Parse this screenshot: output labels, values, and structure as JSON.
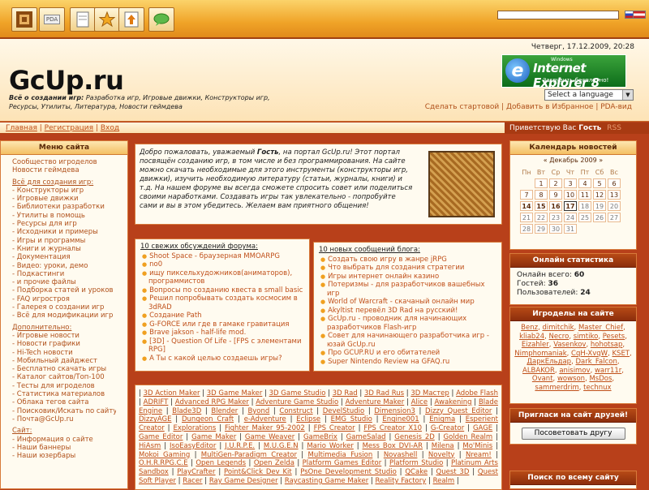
{
  "toolbar": {
    "btn2": "PDA"
  },
  "header": {
    "date": "Четверг, 17.12.2009, 20:28",
    "logo": "GcUp.ru",
    "tagline_bold": "Всё о создании игр:",
    "tagline": " Разработка игр, Игровые движки, Конструкторы игр, Ресурсы, Утилиты, Литература, Новости геймдева",
    "ie_small": "Windows",
    "ie_big": "Internet Explorer 8",
    "ie_sub": "Загрузить бесплатно!",
    "lang": "Select a language",
    "links": "Сделать стартовой | Добавить в Избранное | PDA-вид"
  },
  "nav": {
    "home": "Главная",
    "reg": "Регистрация",
    "login": "Вход",
    "sep": "|",
    "greet": "Приветствую Вас",
    "guest": "Гость",
    "rss": "RSS"
  },
  "menu": {
    "title": "Меню сайта",
    "items": [
      {
        "t": "Сообщество игроделов",
        "s": false
      },
      {
        "t": "Новости геймдева",
        "s": false
      },
      {
        "t": "Всё для создания игр:",
        "s": true
      },
      {
        "t": "- Конструкторы игр",
        "s": false
      },
      {
        "t": "- Игровые движки",
        "s": false
      },
      {
        "t": "- Библиотеки разработки",
        "s": false
      },
      {
        "t": "- Утилиты в помощь",
        "s": false
      },
      {
        "t": "- Ресурсы для игр",
        "s": false
      },
      {
        "t": "- Исходники и примеры",
        "s": false
      },
      {
        "t": "- Игры и программы",
        "s": false
      },
      {
        "t": "- Книги и журналы",
        "s": false
      },
      {
        "t": "- Документация",
        "s": false
      },
      {
        "t": "- Видео: уроки, демо",
        "s": false
      },
      {
        "t": "- Подкаст​инги",
        "s": false
      },
      {
        "t": "- и прочие файлы",
        "s": false
      },
      {
        "t": "- Подборка статей и уроков",
        "s": false
      },
      {
        "t": "- FAQ игрострoя",
        "s": false
      },
      {
        "t": "- Галерея о создании игр",
        "s": false
      },
      {
        "t": "- Всё для модификации игр",
        "s": false
      },
      {
        "t": "Дополнительно:",
        "s": true
      },
      {
        "t": "- Игровые новости",
        "s": false
      },
      {
        "t": "- Новости графики",
        "s": false
      },
      {
        "t": "- Hi-Tech новости",
        "s": false
      },
      {
        "t": "- Мобильный дайджест",
        "s": false
      },
      {
        "t": "- Бесплатно скачать игры",
        "s": false
      },
      {
        "t": "- Каталог сайтов/Топ-100",
        "s": false
      },
      {
        "t": "- Тесты для игроделов",
        "s": false
      },
      {
        "t": "- Статистика материалов",
        "s": false
      },
      {
        "t": "- Облака тегов сайта",
        "s": false
      },
      {
        "t": "- Поисковик/Искать по сайту",
        "s": false
      },
      {
        "t": "- Почта@GcUp.ru",
        "s": false
      },
      {
        "t": "Сайт:",
        "s": true
      },
      {
        "t": "- Информация о сайте",
        "s": false
      },
      {
        "t": "- Наши баннеры",
        "s": false
      },
      {
        "t": "- Наши юзербары",
        "s": false
      }
    ]
  },
  "welcome": {
    "a": "Добро пожаловать, уважаемый ",
    "guest": "Гость",
    "b": ", на портал GcUp.ru! Этот портал посвящён созданию игр, в том числе и без программирования. На сайте можно скачать необходимые для этого инструменты (конструкторы игр, движки), изучить необходимую литературу (статьи, журналы, книги) и т.д. На нашем форуме вы всегда сможете спросить совет или поделиться своими наработками. Создавать игры так увлекательно - попробуйте сами и вы в этом убедитесь. Желаем вам приятного общения!"
  },
  "forum": {
    "title": "10 свежих обсуждений форума:",
    "items": [
      "Shoot Space - браузерная MMOARPG",
      "no0",
      "ищу пиксельхудожников(аниматоров), программистов",
      "Вопросы по созданию квеста в small basic",
      "Решил попробывать создать космосим в 3dRAD",
      "Создание Path",
      "G-FORCE или где в гамаке гравитация",
      "Brave jakson - half-life mod.",
      "[3D] - Question Of Life - [FPS с элементами RPG]",
      "А Ты с какой целью создаешь игры?"
    ]
  },
  "blog": {
    "title": "10 новых сообщений блога:",
    "items": [
      "Создать свою игру в жанре jRPG",
      "Что выбрать для создания стратегии",
      "Игры интернет онлайн казино",
      "Потеризмы - для разработчиков вашебных игр",
      "World of Warcraft - скачаный онлайн мир",
      "Akyltist перевёл 3D Rad на русский!",
      "GcUp.ru - проводник для начинающих разработчиков Flash-игр",
      "Совет для начинающего разработчика игр - юзай GcUp.ru",
      "Про GCUP.RU и его обитателей",
      "Super Nintendo Review на GFAQ.ru"
    ]
  },
  "catalog": [
    "3D Action Maker",
    "3D Game Maker",
    "3D Game Studio",
    "3D Rad",
    "3D Rad Rus",
    "3D Мастер",
    "Adobe Flash",
    "ADRIFT",
    "Advanced RPG Maker",
    "Adventure Game Studio",
    "Adventure Maker",
    "Alice",
    "Awakening",
    "Blade Engine",
    "Blade3D",
    "Blender",
    "Byond",
    "Construct",
    "DevelStudio",
    "Dimension3",
    "Dizzy Quest Editor",
    "DizzyAGE",
    "Dungeon Craft",
    "e-Adventure",
    "Eclipse",
    "EMG Studio",
    "Engine001",
    "Enigma",
    "Esperient Creator",
    "Explorations",
    "Fighter Maker 95-2002",
    "FPS Creator",
    "FPS Creator X10",
    "G-Creator",
    "GAGE",
    "Game Editor",
    "Game Maker",
    "Game Weaver",
    "GameBrix",
    "GameSalad",
    "Genesis 2D",
    "Golden Realm",
    "HiAsm",
    "IsoEasyEditor",
    "J.U.R.P.E.",
    "M.U.G.E.N",
    "Mario Worker",
    "Mess Box DVI-AR",
    "Milena",
    "Mo'Minis",
    "Mokoi Gaming",
    "MultiGen-Paradigm Creator",
    "Multimedia Fusion",
    "Novashell",
    "Novelty",
    "Nream!",
    "O.H.R.RPG.C.E",
    "Open Legends",
    "Open Zelda",
    "Platform Games Editor",
    "Platform Studio",
    "Platinum Arts Sandbox",
    "PlayCrafter",
    "Point&Click Dev Kit",
    "PsOne Development Studio",
    "QCake",
    "Quest 3D",
    "Quest Soft Player",
    "Racer",
    "Ray Game Designer",
    "Raycasting Game Maker",
    "Reality Factory",
    "Realm"
  ],
  "calendar": {
    "title": "Календарь новостей",
    "month": "« Декабрь 2009 »",
    "wk": [
      "Пн",
      "Вт",
      "Ср",
      "Чт",
      "Пт",
      "Сб",
      "Вс"
    ],
    "rows": [
      [
        "",
        "1",
        "2",
        "3",
        "4",
        "5",
        "6"
      ],
      [
        "7",
        "8",
        "9",
        "10",
        "11",
        "12",
        "13"
      ],
      [
        "14",
        "15",
        "16",
        "17",
        "18",
        "19",
        "20"
      ],
      [
        "21",
        "22",
        "23",
        "24",
        "25",
        "26",
        "27"
      ],
      [
        "28",
        "29",
        "30",
        "31",
        "",
        "",
        ""
      ]
    ]
  },
  "stats": {
    "title": "Онлайн статистика",
    "l1": "Онлайн всего:",
    "v1": "60",
    "l2": "Гостей:",
    "v2": "36",
    "l3": "Пользователей:",
    "v3": "24"
  },
  "online": {
    "title": "Игроделы на сайте",
    "users": [
      "Benz",
      "dimitchik",
      "Master_Chief",
      "kliab24",
      "Necro",
      "simtiko",
      "Pesets",
      "Eizahler",
      "Vasenkov",
      "hohotsap",
      "Nimphomaniak",
      "CqH-XvqW",
      "KSET",
      "ДаркЕльдар",
      "Dark_Falcon",
      "ALBAKOR",
      "anisimov",
      "warr11r",
      "Ovant",
      "wowson",
      "MsDos",
      "sammerdrim",
      "technux"
    ]
  },
  "invite": {
    "title": "Пригласи на сайт друзей!",
    "btn": "Посоветовать другу"
  },
  "search": {
    "title": "Поиск по всему сайту"
  }
}
